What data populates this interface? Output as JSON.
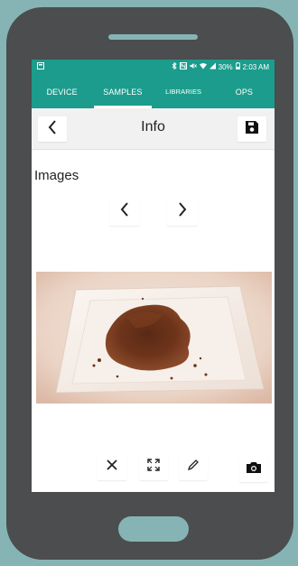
{
  "colors": {
    "background": "#86b4b4",
    "phone_body": "#4b4d4e",
    "accent_teal": "#1c9c8c",
    "speaker": "#86b4b4",
    "home_button": "#86b4b4",
    "toolbar_bg": "#f1f1f1"
  },
  "statusbar": {
    "left_icon": "notification-icon",
    "right_icons": [
      "bluetooth-icon",
      "nfc-icon",
      "mute-icon",
      "wifi-icon",
      "signal-icon"
    ],
    "battery": "30%",
    "time": "2:03 AM"
  },
  "tabs": [
    {
      "label": "DEVICE",
      "active": false
    },
    {
      "label": "SAMPLES",
      "active": true
    },
    {
      "label": "LIBRARIES",
      "active": false
    },
    {
      "label": "OPS",
      "active": false
    }
  ],
  "toolbar": {
    "back_icon": "chevron-left-icon",
    "title": "Info",
    "save_icon": "save-icon"
  },
  "images": {
    "section_label": "Images",
    "prev_icon": "chevron-left-icon",
    "next_icon": "chevron-right-icon",
    "photo_subject": "brown powder sample on white dish"
  },
  "actions": {
    "delete_icon": "close-icon",
    "fullscreen_icon": "expand-icon",
    "edit_icon": "pencil-icon",
    "camera_icon": "camera-icon"
  }
}
